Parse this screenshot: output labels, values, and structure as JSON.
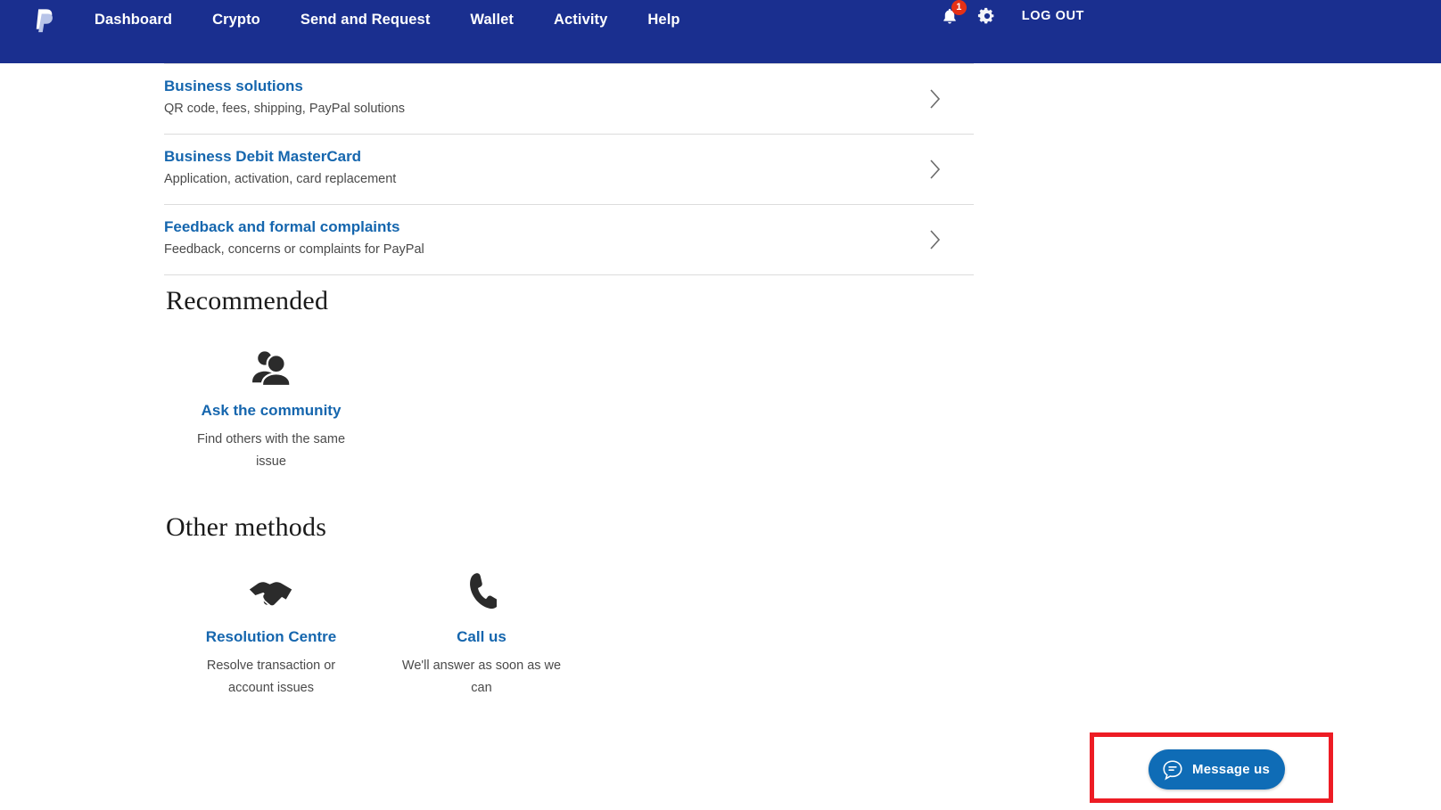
{
  "nav": {
    "logo": "paypal-logo",
    "links": [
      {
        "label": "Dashboard"
      },
      {
        "label": "Crypto"
      },
      {
        "label": "Send and Request"
      },
      {
        "label": "Wallet"
      },
      {
        "label": "Activity"
      },
      {
        "label": "Help"
      }
    ],
    "notifications": {
      "icon": "bell-icon",
      "count": "1"
    },
    "settings": {
      "icon": "gear-icon"
    },
    "logout": {
      "label": "LOG OUT"
    },
    "background_color": "#1A2F8F"
  },
  "topics": [
    {
      "title": "Business solutions",
      "subtitle": "QR code, fees, shipping, PayPal solutions",
      "chevron": "chevron-right-icon"
    },
    {
      "title": "Business Debit MasterCard",
      "subtitle": "Application, activation, card replacement",
      "chevron": "chevron-right-icon"
    },
    {
      "title": "Feedback and formal complaints",
      "subtitle": "Feedback, concerns or complaints for PayPal",
      "chevron": "chevron-right-icon"
    }
  ],
  "recommended": {
    "heading": "Recommended",
    "methods": [
      {
        "icon": "people-community-icon",
        "title": "Ask the community",
        "subtitle": "Find others with the same issue"
      }
    ]
  },
  "other_methods": {
    "heading": "Other methods",
    "methods": [
      {
        "icon": "handshake-icon",
        "title": "Resolution Centre",
        "subtitle": "Resolve transaction or account issues"
      },
      {
        "icon": "phone-icon",
        "title": "Call us",
        "subtitle": "We'll answer as soon as we can"
      }
    ]
  },
  "message_widget": {
    "label": "Message us",
    "icon": "chat-bubble-icon",
    "button_color": "#0F6CB6",
    "highlight_color": "#ED1C24"
  },
  "colors": {
    "link_blue": "#1566AE",
    "text_gray": "#4a4a4a",
    "navy": "#1A2F8F",
    "divider": "#dcdcdc"
  }
}
